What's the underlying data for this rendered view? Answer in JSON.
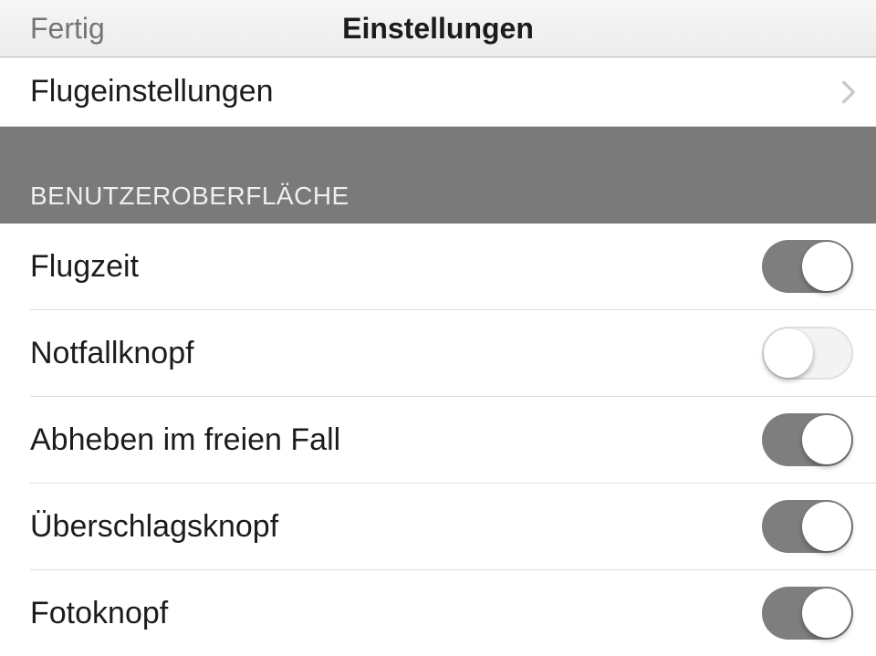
{
  "navbar": {
    "done_label": "Fertig",
    "title": "Einstellungen"
  },
  "nav_row": {
    "label": "Flugeinstellungen"
  },
  "section": {
    "header": "BENUTZEROBERFLÄCHE"
  },
  "rows": [
    {
      "label": "Flugzeit",
      "on": true
    },
    {
      "label": "Notfallknopf",
      "on": false
    },
    {
      "label": "Abheben im freien Fall",
      "on": true
    },
    {
      "label": "Überschlagsknopf",
      "on": true
    },
    {
      "label": "Fotoknopf",
      "on": true
    }
  ]
}
